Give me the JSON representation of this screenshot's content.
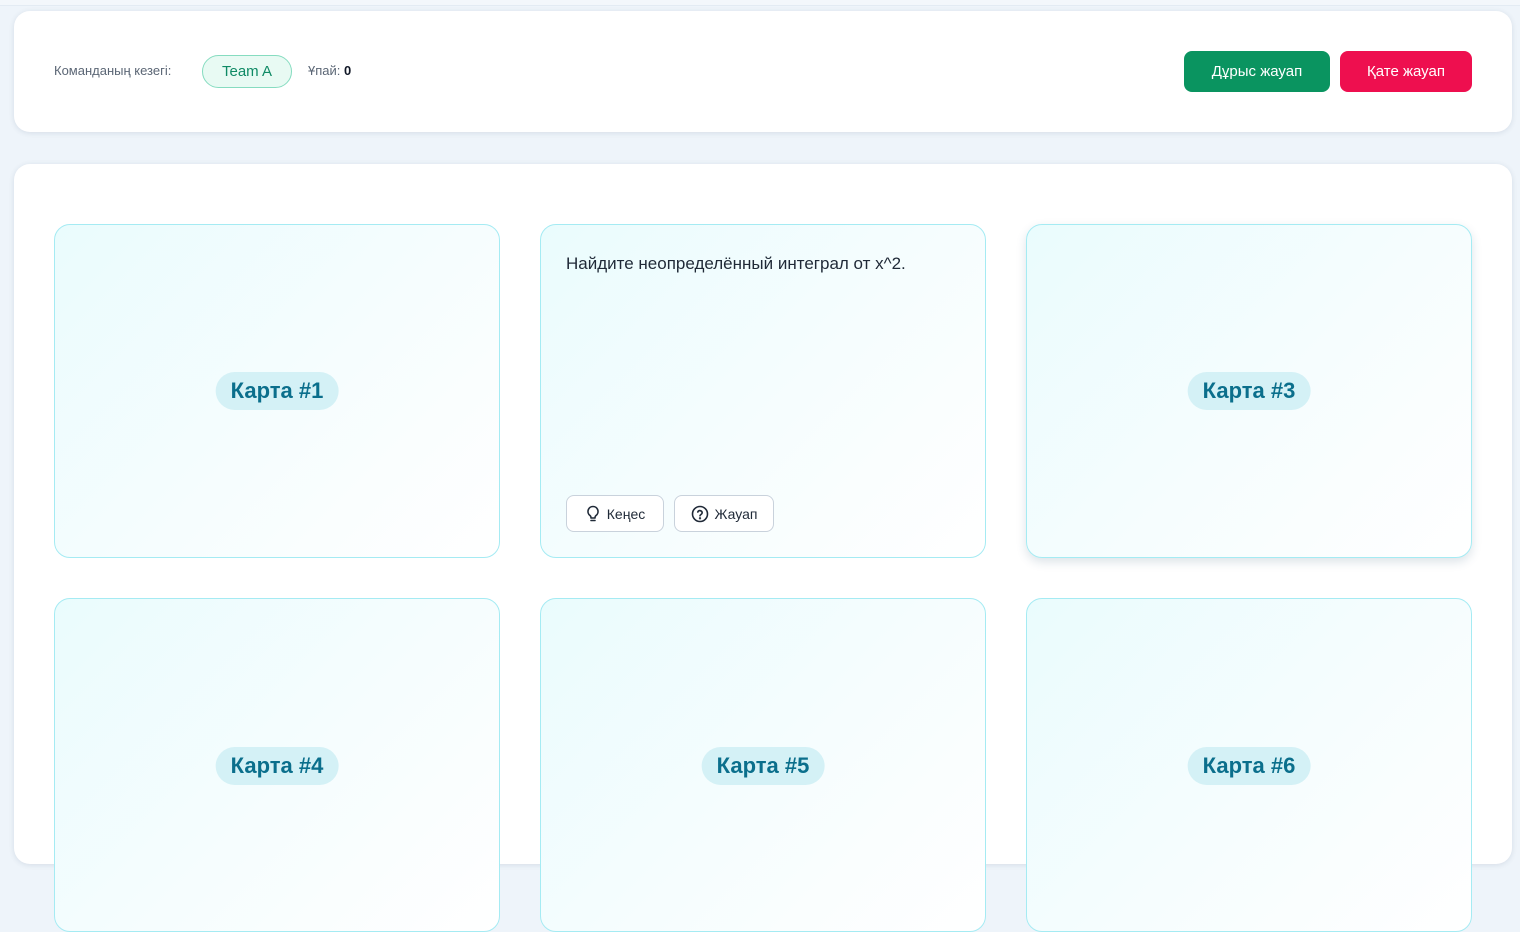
{
  "header": {
    "turn_label": "Команданың кезегі:",
    "team_name": "Team A",
    "score_label": "Ұпай:",
    "score_value": "0",
    "correct_button": "Дұрыс жауап",
    "wrong_button": "Қате жауап"
  },
  "cards": [
    {
      "label": "Карта #1"
    },
    {
      "question": "Найдите неопределённый интеграл от x^2.",
      "hint_button": "Кеңес",
      "answer_button": "Жауап"
    },
    {
      "label": "Карта #3"
    },
    {
      "label": "Карта #4"
    },
    {
      "label": "Карта #5"
    },
    {
      "label": "Карта #6"
    }
  ],
  "icons": {
    "hint": "lightbulb-icon",
    "answer": "question-circle-icon"
  },
  "colors": {
    "correct": "#0a9460",
    "wrong": "#ee0f4f",
    "accent": "#0b6f8c",
    "team": "#0f8a65"
  }
}
